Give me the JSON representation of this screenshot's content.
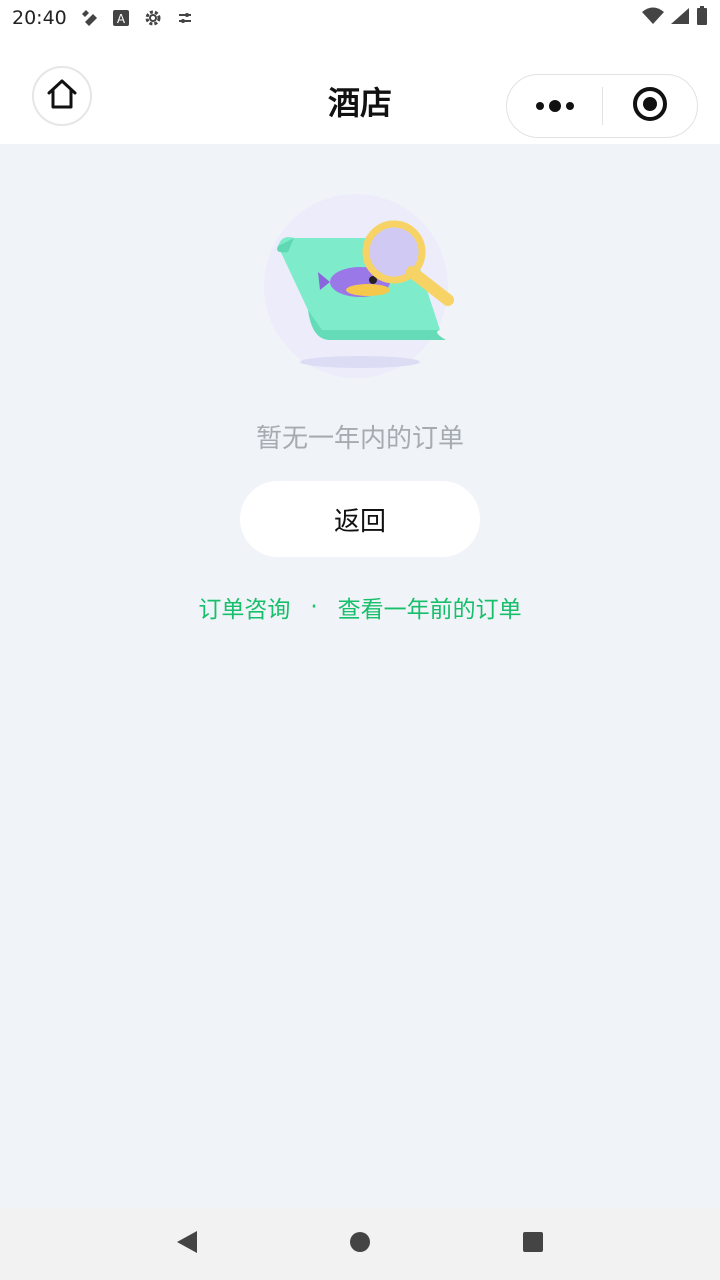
{
  "status_bar": {
    "time": "20:40",
    "left_icons": [
      "tool-icon",
      "a-letter-icon",
      "settings-gear-icon",
      "tune-icon"
    ],
    "right_icons": [
      "wifi-icon",
      "cell-signal-icon",
      "battery-icon"
    ]
  },
  "header": {
    "title": "酒店",
    "home_icon": "home-icon",
    "menu_icon": "more-dots-icon",
    "close_icon": "target-close-icon"
  },
  "empty_state": {
    "illustration": "fish-scroll-magnifier-illustration",
    "message": "暂无一年内的订单",
    "back_button": "返回"
  },
  "links": {
    "order_inquiry": "订单咨询",
    "separator": "·",
    "older_orders": "查看一年前的订单"
  },
  "colors": {
    "accent_green": "#17bf6b",
    "background": "#f0f4f8",
    "muted_text": "#a6abb2"
  },
  "system_nav": {
    "back": "back-triangle-icon",
    "home": "home-circle-icon",
    "recents": "recents-square-icon"
  }
}
